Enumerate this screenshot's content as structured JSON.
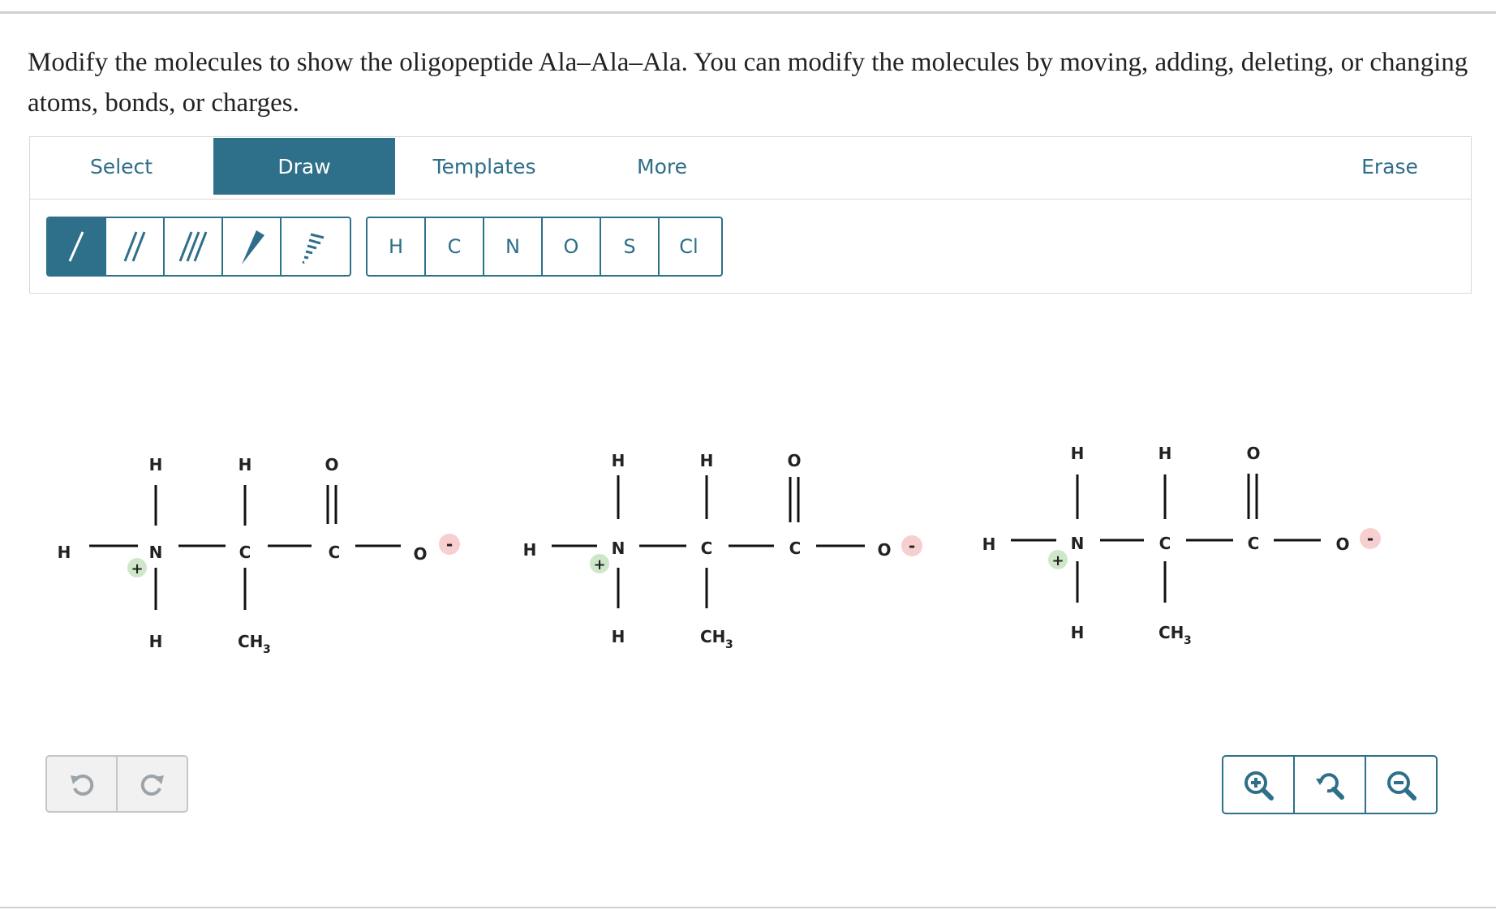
{
  "prompt": "Modify the molecules to show the oligopeptide Ala–Ala–Ala. You can modify the molecules by moving, adding, deleting, or changing atoms, bonds, or charges.",
  "tabs": {
    "select": "Select",
    "draw": "Draw",
    "templates": "Templates",
    "more": "More",
    "erase": "Erase"
  },
  "elements": [
    "H",
    "C",
    "N",
    "O",
    "S",
    "Cl"
  ],
  "bond_tools": [
    "single-bond",
    "double-bond",
    "triple-bond",
    "wedge-bond",
    "hash-bond"
  ],
  "molecule": {
    "h": "H",
    "n": "N",
    "c": "C",
    "o": "O",
    "ch": "CH",
    "sub3": "3",
    "plus": "+",
    "minus": "-"
  },
  "colors": {
    "accent": "#2e7089",
    "plus_badge": "#cfe7c9",
    "minus_badge": "#f7cfcf"
  },
  "icons": {
    "undo": "undo-icon",
    "redo": "redo-icon",
    "zoom_in": "zoom-in-icon",
    "zoom_reset": "zoom-reset-icon",
    "zoom_out": "zoom-out-icon"
  }
}
